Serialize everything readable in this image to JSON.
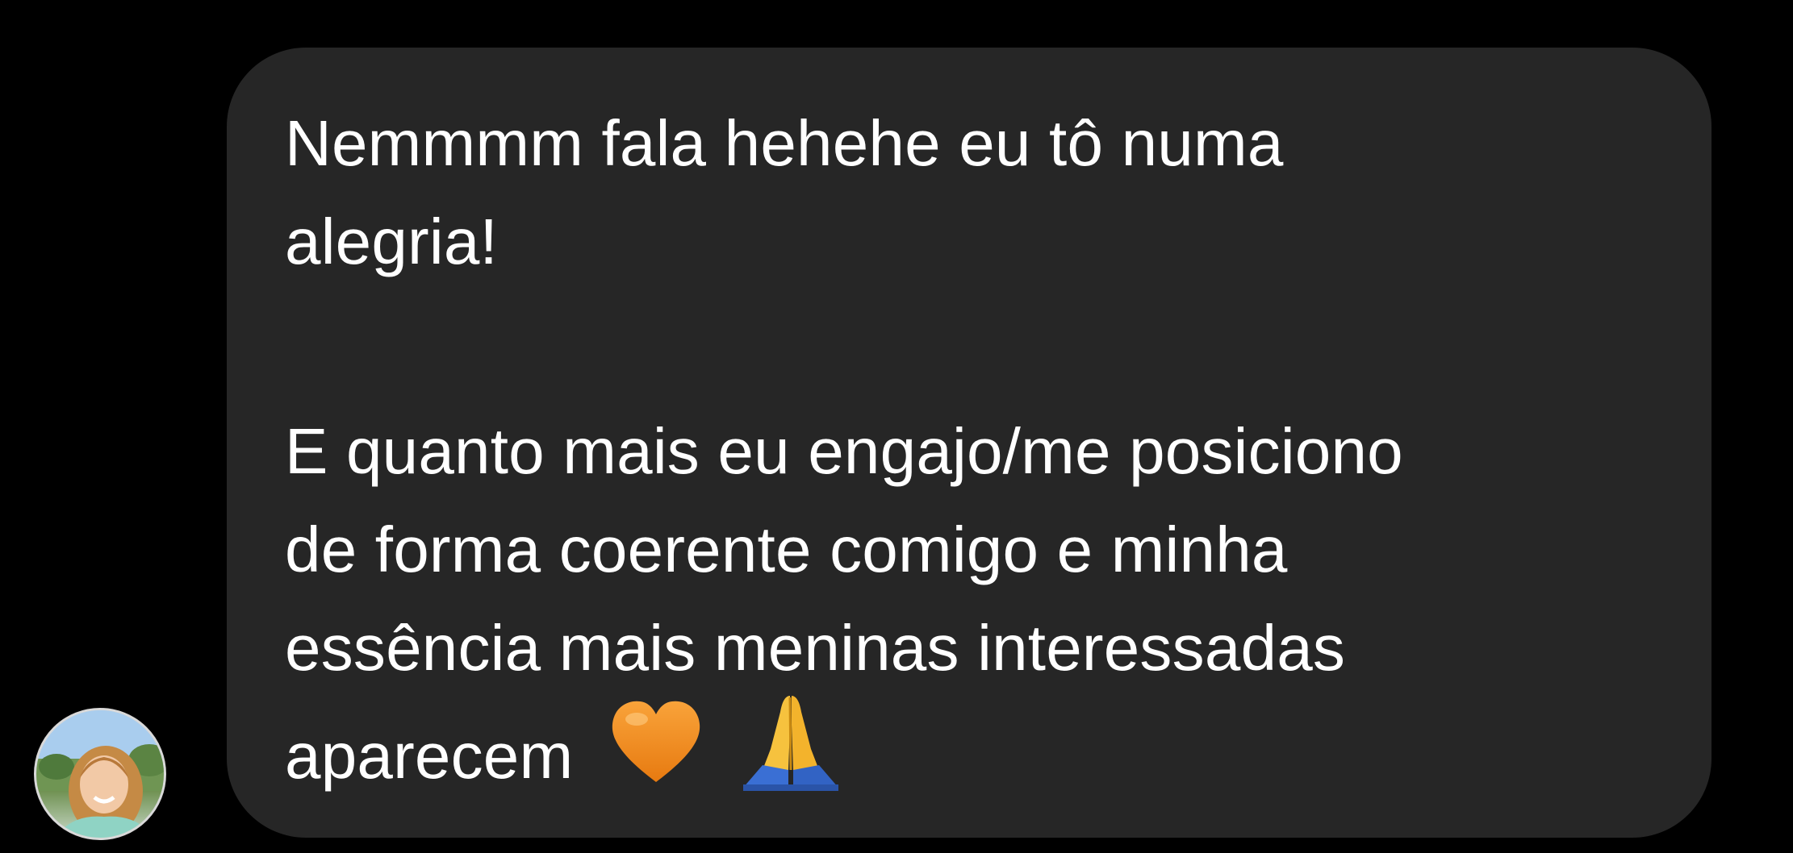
{
  "message": {
    "lines_part1": [
      "Nemmmm fala hehehe eu tô numa",
      "alegria!"
    ],
    "lines_part2": [
      "E quanto mais eu engajo/me posiciono",
      "de forma coerente comigo e minha",
      "essência mais meninas interessadas"
    ],
    "last_line_text": "aparecem",
    "emojis": [
      "orange-heart-icon",
      "folded-hands-icon"
    ]
  },
  "colors": {
    "background": "#000000",
    "bubble": "#262626",
    "text": "#ffffff",
    "heart": "#f4901e",
    "hands": "#f6c23e",
    "sleeve": "#3a6fd4"
  }
}
